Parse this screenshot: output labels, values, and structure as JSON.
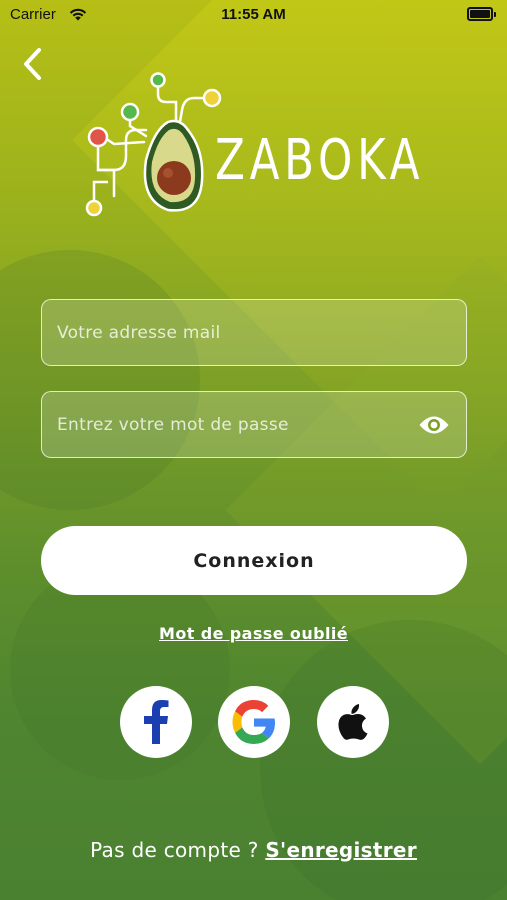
{
  "status_bar": {
    "carrier": "Carrier",
    "time": "11:55 AM"
  },
  "brand": {
    "name": "ZABOKA"
  },
  "form": {
    "email_placeholder": "Votre adresse mail",
    "email_value": "",
    "password_placeholder": "Entrez votre mot de passe",
    "password_value": ""
  },
  "actions": {
    "login_label": "Connexion",
    "forgot_password_label": "Mot de passe oublié"
  },
  "social": [
    {
      "name": "facebook",
      "icon": "facebook-icon",
      "color": "#1a3fb0"
    },
    {
      "name": "google",
      "icon": "google-icon",
      "color": "#4285f4"
    },
    {
      "name": "apple",
      "icon": "apple-icon",
      "color": "#111111"
    }
  ],
  "footer": {
    "no_account_text": "Pas de compte ?",
    "register_label": "S'enregistrer"
  },
  "colors": {
    "background_top": "#b7bf16",
    "background_bottom": "#4a8131",
    "button_bg": "#ffffff",
    "text_light": "#ffffff"
  }
}
